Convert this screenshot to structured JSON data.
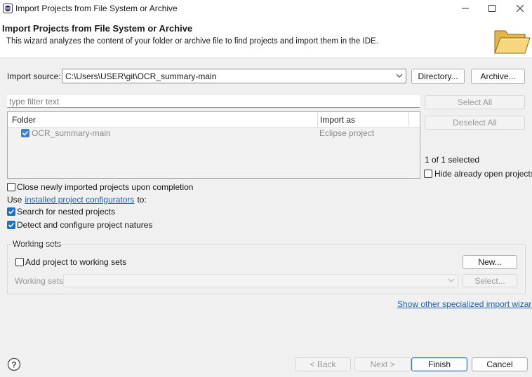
{
  "window": {
    "title": "Import Projects from File System or Archive",
    "icon": "eclipse-icon",
    "controls": [
      "minimize-icon",
      "maximize-icon",
      "close-icon"
    ]
  },
  "header": {
    "title": "Import Projects from File System or Archive",
    "description": "This wizard analyzes the content of your folder or archive file to find projects and import them in the IDE.",
    "icon": "folder-icon"
  },
  "import_source": {
    "label": "Import source:",
    "value": "C:\\Users\\USER\\git\\OCR_summary-main",
    "directory_button": "Directory...",
    "archive_button": "Archive..."
  },
  "filter": {
    "placeholder": "type filter text"
  },
  "table": {
    "columns": [
      "Folder",
      "Import as"
    ],
    "rows": [
      {
        "folder": "OCR_summary-main",
        "import_as": "Eclipse project",
        "checked": true
      }
    ]
  },
  "side": {
    "select_all": "Select All",
    "deselect_all": "Deselect All",
    "selected_count": "1 of 1 selected",
    "hide_open_label": "Hide already open projects"
  },
  "options": {
    "close_newly": "Close newly imported projects upon completion",
    "use_prefix": "Use",
    "configurators_link": "installed project configurators",
    "use_suffix": "to:",
    "search_nested": "Search for nested projects",
    "detect_natures": "Detect and configure project natures"
  },
  "working_sets": {
    "group_title": "Working sets",
    "add_label": "Add project to working sets",
    "new_button": "New...",
    "sets_label": "Working sets:",
    "select_button": "Select..."
  },
  "show_other_link": "Show other specialized import wizards",
  "footer": {
    "back": "< Back",
    "next": "Next >",
    "finish": "Finish",
    "cancel": "Cancel"
  },
  "colors": {
    "accent": "#1f6fc5",
    "link": "#1f5fb0"
  }
}
